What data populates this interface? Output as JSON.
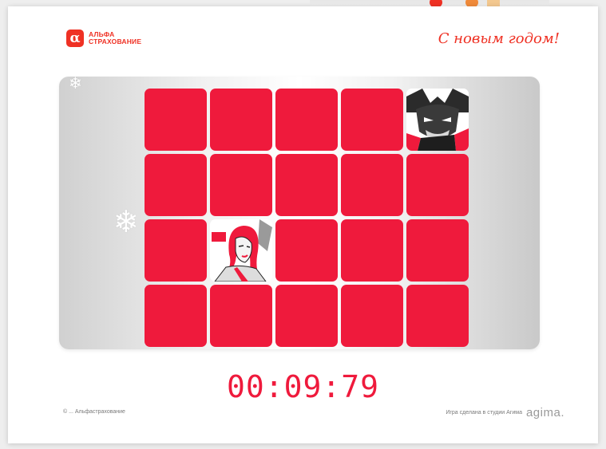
{
  "brand": {
    "logo_mark": "α",
    "logo_line1": "АЛЬФА",
    "logo_line2": "СТРАХОВАНИЕ",
    "greeting": "С новым годом!"
  },
  "game": {
    "rows": 4,
    "cols": 5,
    "opened_cards": [
      {
        "row": 0,
        "col": 4,
        "image": "batman-comic-icon"
      },
      {
        "row": 2,
        "col": 1,
        "image": "red-haired-woman-comic-icon"
      }
    ],
    "timer": "00:09:79"
  },
  "footer": {
    "copyright": "© ... Альфастрахование",
    "credit": "Игра сделана в студии Агима",
    "studio_logo": "agima."
  },
  "colors": {
    "card": "#ef1a3c",
    "brand": "#ef3124"
  }
}
